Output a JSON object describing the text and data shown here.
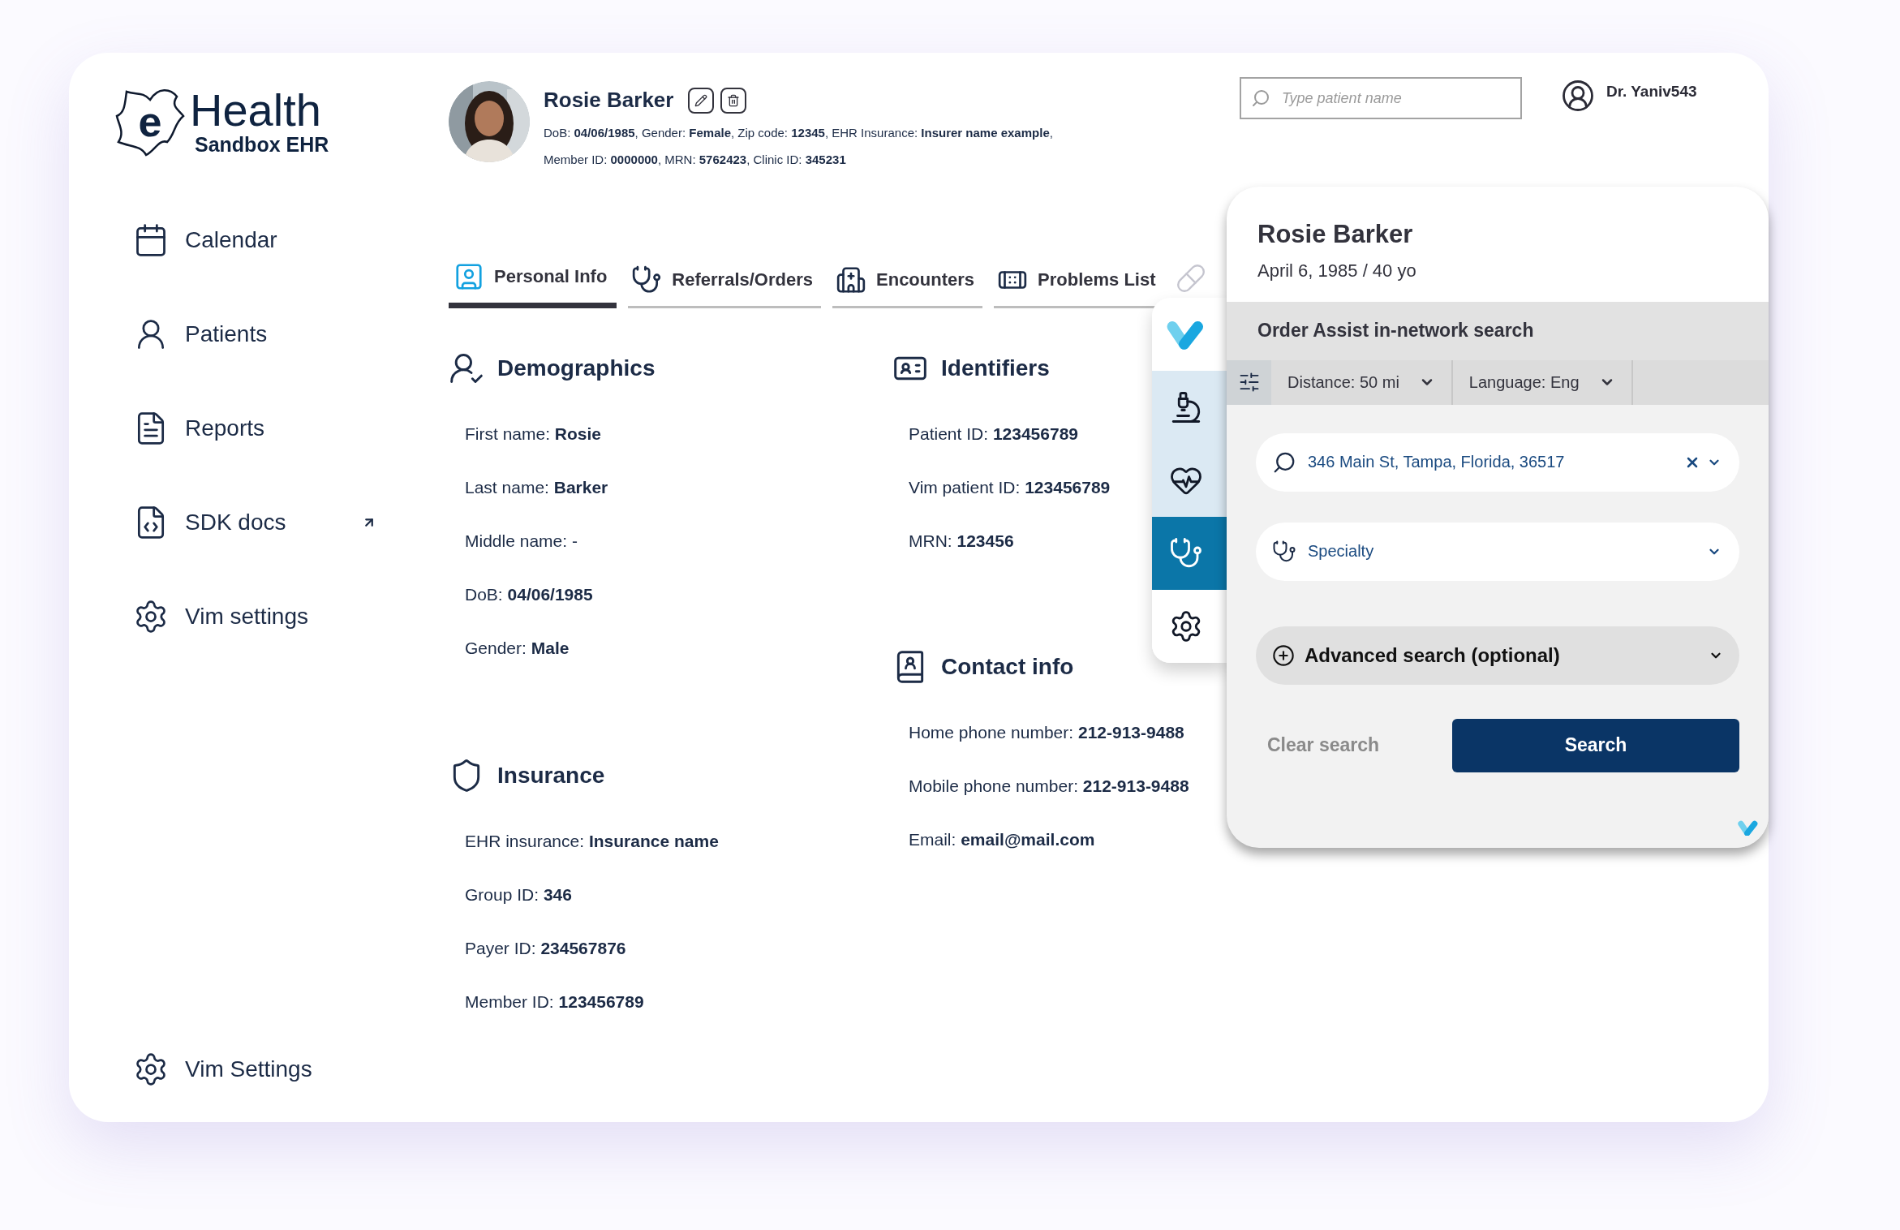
{
  "logo": {
    "mark": "e",
    "word": "Health",
    "subtitle": "Sandbox EHR"
  },
  "sidebar": {
    "items": [
      {
        "label": "Calendar",
        "kind": "calendar",
        "external": false
      },
      {
        "label": "Patients",
        "kind": "patients",
        "external": false
      },
      {
        "label": "Reports",
        "kind": "reports",
        "external": false
      },
      {
        "label": "SDK docs",
        "kind": "docs",
        "external": true
      },
      {
        "label": "Vim settings",
        "kind": "settings",
        "external": false
      }
    ],
    "footer": {
      "label": "Vim Settings",
      "kind": "settings"
    }
  },
  "patient": {
    "name": "Rosie Barker",
    "details": [
      "DoB: **04/06/1985**, Gender: **Female**, Zip code: **12345**, EHR Insurance: **Insurer name example**,",
      "Member ID: **0000000**, MRN: **5762423**, Clinic ID: **345231**"
    ]
  },
  "search": {
    "placeholder": "Type patient name"
  },
  "user": {
    "name": "Dr. Yaniv543"
  },
  "tabs": [
    {
      "label": "Personal Info",
      "kind": "badge",
      "selected": true
    },
    {
      "label": "Referrals/Orders",
      "kind": "stethoscope",
      "selected": false
    },
    {
      "label": "Encounters",
      "kind": "hospital",
      "selected": false
    },
    {
      "label": "Problems List",
      "kind": "bandage",
      "selected": false
    }
  ],
  "sections": {
    "demographics": {
      "title": "Demographics",
      "rows": [
        "First name: **Rosie**",
        "Last name: **Barker**",
        "Middle name: -",
        "DoB: **04/06/1985**",
        "Gender: **Male**"
      ]
    },
    "insurance": {
      "title": "Insurance",
      "rows": [
        "EHR insurance: **Insurance name**",
        "Group ID: **346**",
        "Payer ID: **234567876**",
        "Member ID: **123456789**"
      ]
    },
    "identifiers": {
      "title": "Identifiers",
      "rows": [
        "Patient ID: **123456789**",
        "Vim patient ID: **123456789**",
        "MRN: **123456**"
      ]
    },
    "contact": {
      "title": "Contact info",
      "rows": [
        "Home phone number: **212-913-9488**",
        "Mobile phone number: **212-913-9488**",
        "Email: **email@mail.com**"
      ]
    }
  },
  "rail": {
    "items": [
      {
        "kind": "microscope",
        "highlighted": true,
        "selected": false
      },
      {
        "kind": "heart-pulse",
        "highlighted": true,
        "selected": false
      },
      {
        "kind": "stethoscope",
        "highlighted": false,
        "selected": true
      },
      {
        "kind": "gear",
        "highlighted": false,
        "selected": false
      }
    ]
  },
  "order_panel": {
    "patient_name": "Rosie Barker",
    "patient_age": "April 6, 1985 / 40 yo",
    "title": "Order Assist in-network search",
    "filters": [
      {
        "label": "Distance: 50 mi"
      },
      {
        "label": "Language: Eng"
      }
    ],
    "address": {
      "value": "346 Main St, Tampa, Florida, 36517"
    },
    "specialty": {
      "placeholder": "Specialty"
    },
    "advanced": {
      "label": "Advanced search (optional)",
      "expanded": false
    },
    "clear_label": "Clear search",
    "search_label": "Search"
  }
}
